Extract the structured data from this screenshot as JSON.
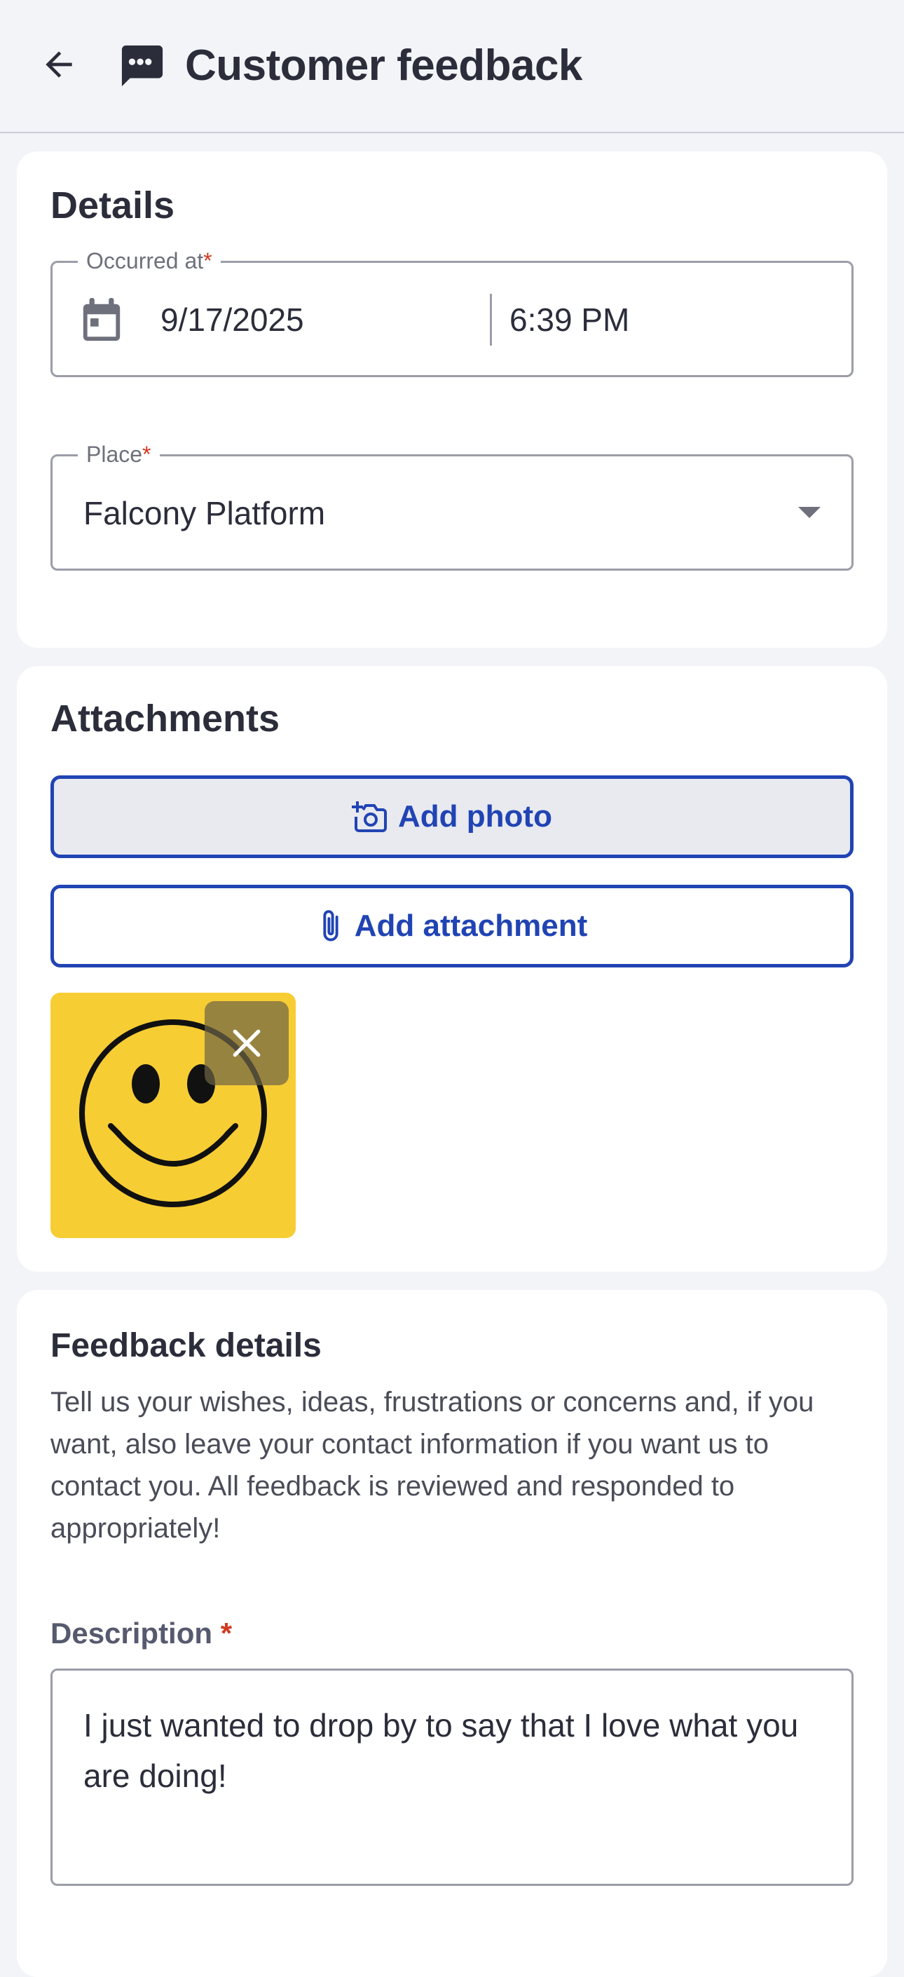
{
  "header": {
    "title": "Customer feedback",
    "back_icon": "arrow-left-icon",
    "title_icon": "chat-bubble-icon"
  },
  "details": {
    "title": "Details",
    "occurred_at": {
      "label": "Occurred at",
      "required_mark": "*",
      "date": "9/17/2025",
      "time": "6:39 PM",
      "icon": "calendar-icon"
    },
    "place": {
      "label": "Place",
      "required_mark": "*",
      "value": "Falcony Platform"
    }
  },
  "attachments": {
    "title": "Attachments",
    "add_photo_label": "Add photo",
    "add_attachment_label": "Add attachment",
    "thumbnail": "smiley-face-image"
  },
  "feedback": {
    "title": "Feedback details",
    "help_text": "Tell us your wishes, ideas, frustrations or concerns and, if you want, also leave your contact information if you want us to contact you. All feedback is reviewed and responded to appropriately!",
    "description_label": "Description",
    "required_mark": "*",
    "description_value": "I just wanted to drop by to say that I love what you are doing!"
  },
  "colors": {
    "accent": "#2144b4",
    "required": "#d2391f",
    "background": "#f3f4f8",
    "thumbnail_bg": "#f7cd34"
  }
}
